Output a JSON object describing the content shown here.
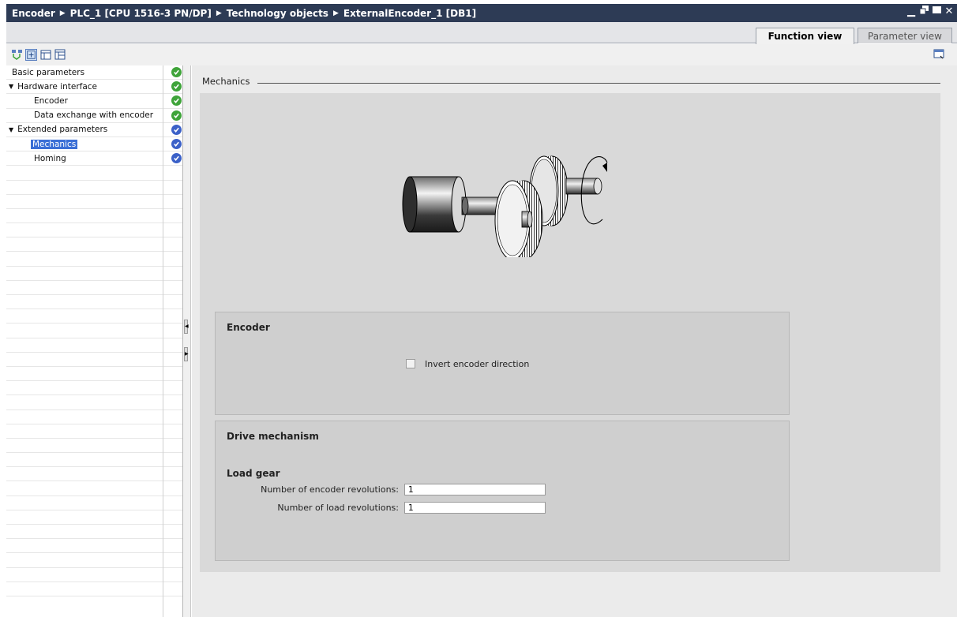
{
  "titlebar": {
    "crumbs": [
      "Encoder",
      "PLC_1 [CPU 1516-3 PN/DP]",
      "Technology objects",
      "ExternalEncoder_1 [DB1]"
    ],
    "separator": "▶"
  },
  "tabs": {
    "function_view": "Function view",
    "parameter_view": "Parameter view"
  },
  "nav": {
    "items": [
      {
        "label": "Basic parameters",
        "status": "green"
      },
      {
        "label": "Hardware interface",
        "status": "green"
      },
      {
        "label": "Encoder",
        "status": "green"
      },
      {
        "label": "Data exchange with encoder",
        "status": "green"
      },
      {
        "label": "Extended parameters",
        "status": "blue"
      },
      {
        "label": "Mechanics",
        "status": "blue"
      },
      {
        "label": "Homing",
        "status": "blue"
      }
    ]
  },
  "main": {
    "section_title": "Mechanics",
    "encoder_group": {
      "title": "Encoder",
      "invert_label": "Invert encoder direction",
      "invert_checked": false
    },
    "drive_group": {
      "title": "Drive mechanism",
      "load_gear_title": "Load gear",
      "encoder_revs_label": "Number of encoder revolutions:",
      "encoder_revs_value": "1",
      "load_revs_label": "Number of load revolutions:",
      "load_revs_value": "1"
    }
  },
  "colors": {
    "titlebar": "#2d3b55",
    "selection": "#3b6fd6",
    "status_green": "#3fa43a",
    "status_blue": "#3b61c8"
  }
}
